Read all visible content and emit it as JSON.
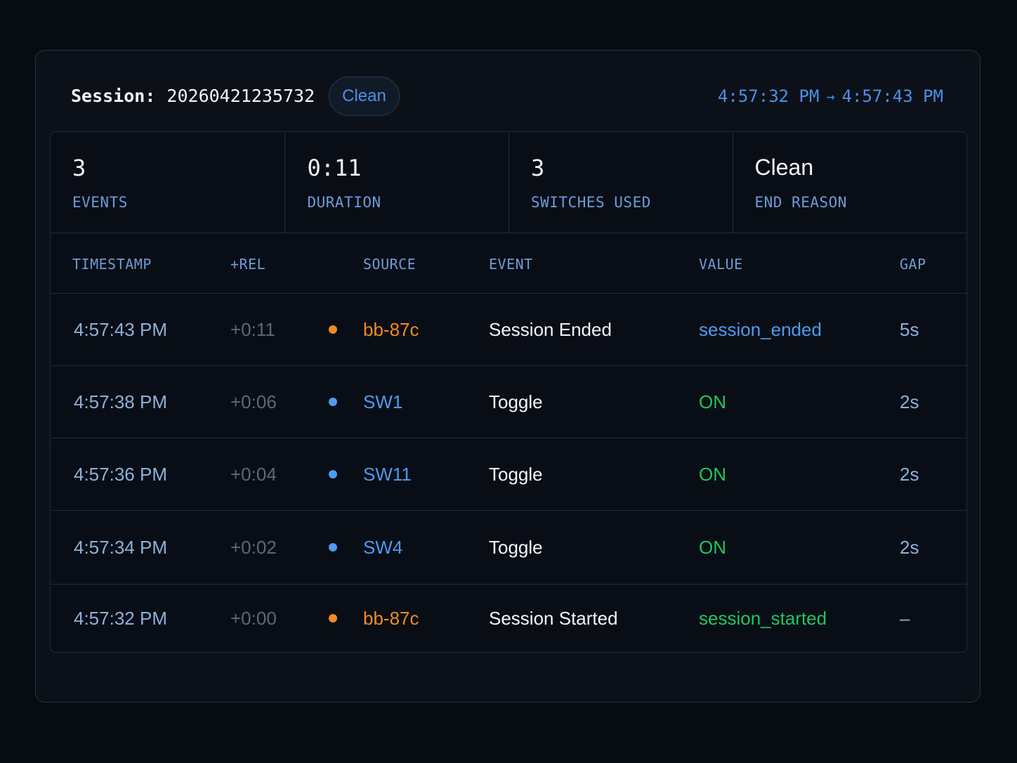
{
  "header": {
    "session_label": "Session:",
    "session_id": "20260421235732",
    "status_badge": "Clean",
    "time_start": "4:57:32 PM",
    "time_arrow": "→",
    "time_end": "4:57:43 PM"
  },
  "stats": [
    {
      "value": "3",
      "label": "EVENTS"
    },
    {
      "value": "0:11",
      "label": "DURATION"
    },
    {
      "value": "3",
      "label": "SWITCHES USED"
    },
    {
      "value": "Clean",
      "label": "END REASON"
    }
  ],
  "table": {
    "columns": [
      "TIMESTAMP",
      "+REL",
      "SOURCE",
      "EVENT",
      "VALUE",
      "GAP"
    ],
    "rows": [
      {
        "timestamp": "4:57:43 PM",
        "rel": "+0:11",
        "source": "bb-87c",
        "source_kind": "device",
        "event": "Session Ended",
        "value": "session_ended",
        "value_color": "blue",
        "gap": "5s"
      },
      {
        "timestamp": "4:57:38 PM",
        "rel": "+0:06",
        "source": "SW1",
        "source_kind": "switch",
        "event": "Toggle",
        "value": "ON",
        "value_color": "green",
        "gap": "2s"
      },
      {
        "timestamp": "4:57:36 PM",
        "rel": "+0:04",
        "source": "SW11",
        "source_kind": "switch",
        "event": "Toggle",
        "value": "ON",
        "value_color": "green",
        "gap": "2s"
      },
      {
        "timestamp": "4:57:34 PM",
        "rel": "+0:02",
        "source": "SW4",
        "source_kind": "switch",
        "event": "Toggle",
        "value": "ON",
        "value_color": "green",
        "gap": "2s"
      },
      {
        "timestamp": "4:57:32 PM",
        "rel": "+0:00",
        "source": "bb-87c",
        "source_kind": "device",
        "event": "Session Started",
        "value": "session_started",
        "value_color": "green",
        "gap": "–"
      }
    ]
  },
  "colors": {
    "device": "#f08a24",
    "switch": "#4e9af0",
    "value_blue": "#4e9af0",
    "value_green": "#22c55e",
    "accent": "#4e8ee8"
  }
}
